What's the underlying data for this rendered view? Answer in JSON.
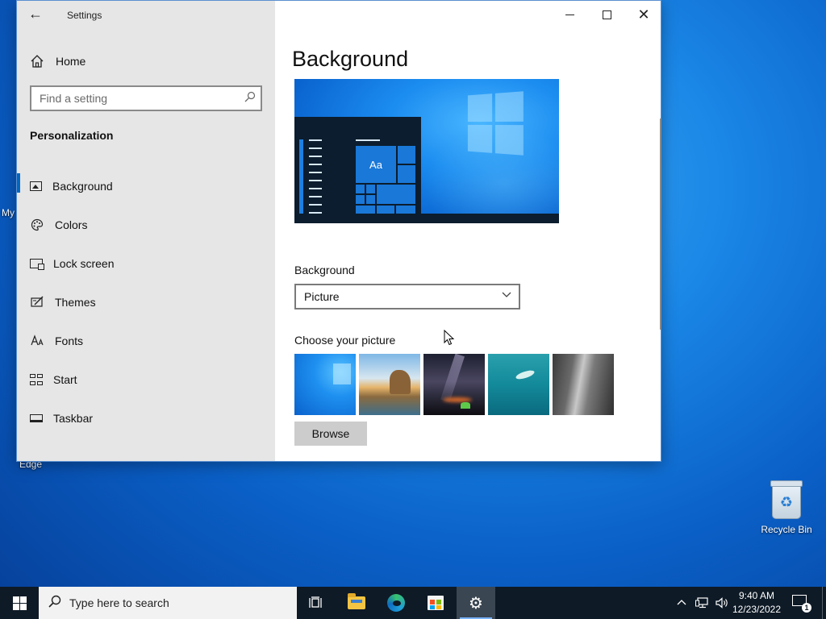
{
  "window": {
    "app_title": "Settings",
    "controls": {
      "minimize": "—",
      "maximize": "□",
      "close": "✕"
    }
  },
  "sidebar": {
    "home_label": "Home",
    "search_placeholder": "Find a setting",
    "section_title": "Personalization",
    "items": [
      {
        "label": "Background",
        "icon": "image-icon",
        "active": true
      },
      {
        "label": "Colors",
        "icon": "palette-icon",
        "active": false
      },
      {
        "label": "Lock screen",
        "icon": "lock-screen-icon",
        "active": false
      },
      {
        "label": "Themes",
        "icon": "themes-icon",
        "active": false
      },
      {
        "label": "Fonts",
        "icon": "fonts-icon",
        "active": false
      },
      {
        "label": "Start",
        "icon": "start-icon",
        "active": false
      },
      {
        "label": "Taskbar",
        "icon": "taskbar-icon",
        "active": false
      }
    ]
  },
  "content": {
    "page_title": "Background",
    "preview_tile_text": "Aa",
    "background_label": "Background",
    "background_value": "Picture",
    "choose_label": "Choose your picture",
    "browse_label": "Browse"
  },
  "desktop": {
    "recycle_bin_label": "Recycle Bin",
    "peek_labels": [
      "My",
      "Edge"
    ]
  },
  "taskbar": {
    "search_placeholder": "Type here to search",
    "time": "9:40 AM",
    "date": "12/23/2022",
    "notification_count": "1"
  },
  "colors": {
    "accent": "#0067c0",
    "sidebar_bg": "#e6e6e6",
    "taskbar_bg": "#0e1a26"
  }
}
